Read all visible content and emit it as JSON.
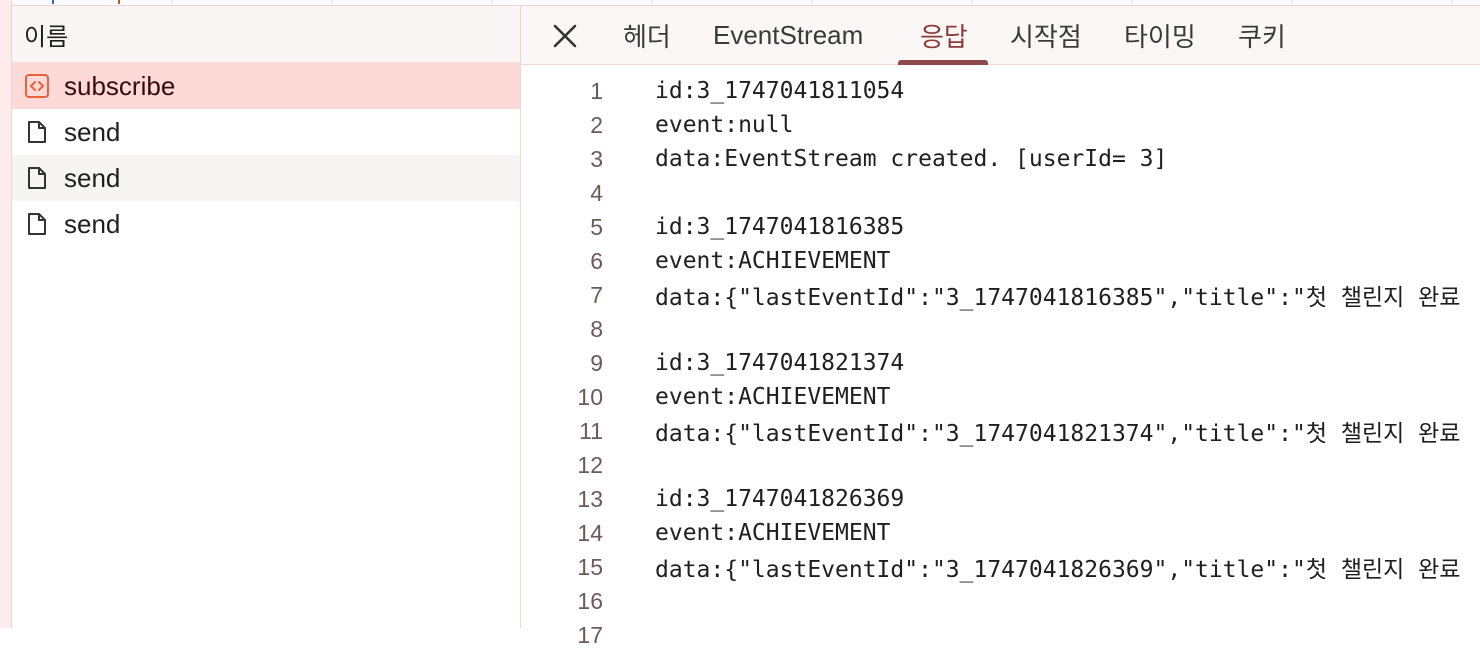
{
  "name_panel": {
    "header": "이름",
    "requests": [
      {
        "name": "subscribe",
        "icon": "eventstream-icon",
        "selected": true
      },
      {
        "name": "send",
        "icon": "document-icon",
        "selected": false
      },
      {
        "name": "send",
        "icon": "document-icon",
        "selected": false
      },
      {
        "name": "send",
        "icon": "document-icon",
        "selected": false
      }
    ]
  },
  "tabs": [
    {
      "label": "헤더"
    },
    {
      "label": "EventStream"
    },
    {
      "label": "응답",
      "active": true
    },
    {
      "label": "시작점"
    },
    {
      "label": "타이밍"
    },
    {
      "label": "쿠키"
    }
  ],
  "response_lines": [
    {
      "num": "1",
      "text": "id:3_1747041811054"
    },
    {
      "num": "2",
      "text": "event:null"
    },
    {
      "num": "3",
      "text": "data:EventStream created. [userId= 3]"
    },
    {
      "num": "4",
      "text": ""
    },
    {
      "num": "5",
      "text": "id:3_1747041816385"
    },
    {
      "num": "6",
      "text": "event:ACHIEVEMENT"
    },
    {
      "num": "7",
      "text": "data:{\"lastEventId\":\"3_1747041816385\",\"title\":\"첫 챌린지 완료"
    },
    {
      "num": "8",
      "text": ""
    },
    {
      "num": "9",
      "text": "id:3_1747041821374"
    },
    {
      "num": "10",
      "text": "event:ACHIEVEMENT"
    },
    {
      "num": "11",
      "text": "data:{\"lastEventId\":\"3_1747041821374\",\"title\":\"첫 챌린지 완료"
    },
    {
      "num": "12",
      "text": ""
    },
    {
      "num": "13",
      "text": "id:3_1747041826369"
    },
    {
      "num": "14",
      "text": "event:ACHIEVEMENT"
    },
    {
      "num": "15",
      "text": "data:{\"lastEventId\":\"3_1747041826369\",\"title\":\"첫 챌린지 완료"
    },
    {
      "num": "16",
      "text": ""
    },
    {
      "num": "17",
      "text": ""
    }
  ],
  "colors": {
    "selected_row": "#fddad7",
    "accent": "#8c4a4a",
    "eventstream_icon": "#e8623a"
  }
}
